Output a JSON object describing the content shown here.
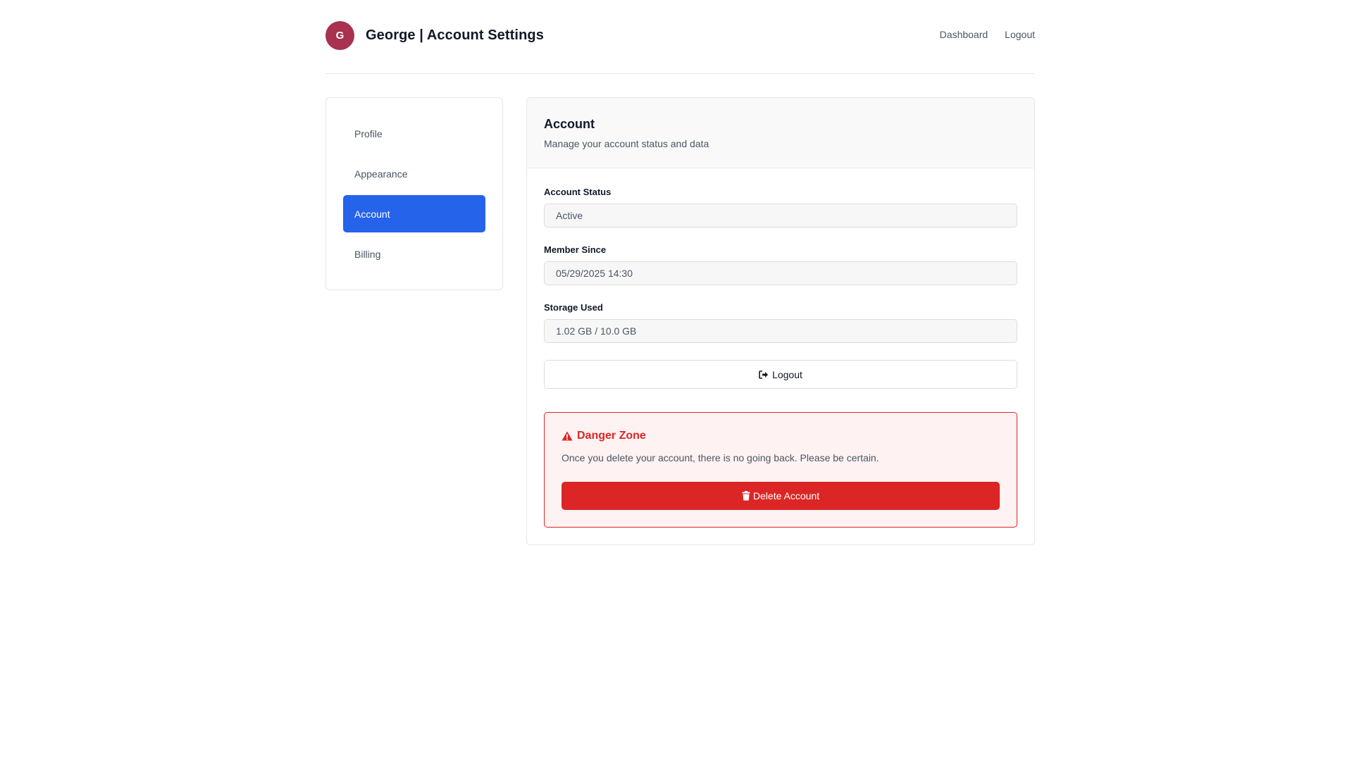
{
  "header": {
    "avatar_initial": "G",
    "title": "George | Account Settings",
    "nav": {
      "dashboard": "Dashboard",
      "logout": "Logout"
    }
  },
  "sidebar": {
    "items": [
      {
        "label": "Profile",
        "active": false
      },
      {
        "label": "Appearance",
        "active": false
      },
      {
        "label": "Account",
        "active": true
      },
      {
        "label": "Billing",
        "active": false
      }
    ]
  },
  "panel": {
    "title": "Account",
    "subtitle": "Manage your account status and data",
    "fields": [
      {
        "label": "Account Status",
        "value": "Active"
      },
      {
        "label": "Member Since",
        "value": "05/29/2025 14:30"
      },
      {
        "label": "Storage Used",
        "value": "1.02 GB / 10.0 GB"
      }
    ],
    "logout_button": {
      "label": "Logout",
      "icon": "sign-out-icon"
    }
  },
  "danger_zone": {
    "title": "Danger Zone",
    "icon": "warning-icon",
    "text": "Once you delete your account, there is no going back. Please be certain.",
    "delete_button": {
      "label": "Delete Account",
      "icon": "trash-icon"
    }
  },
  "colors": {
    "accent": "#2563eb",
    "danger": "#dc2626",
    "avatar": "#a83250"
  }
}
